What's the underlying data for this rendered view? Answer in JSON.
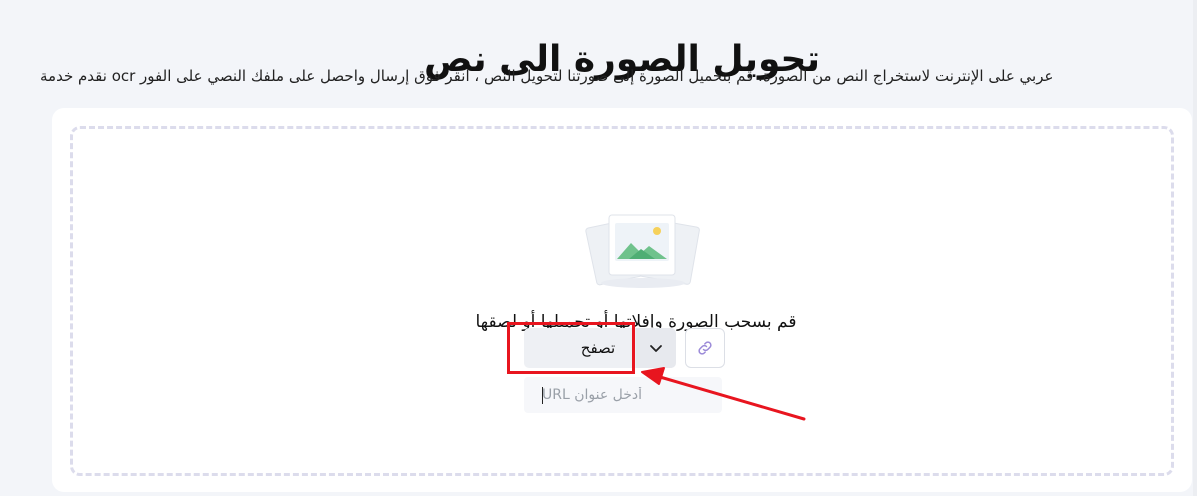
{
  "header": {
    "title": "تحويل الصورة الى نص",
    "subtitle": "نقدم خدمة ocr على الفور على ملفك النصي واحصل على إرسال فوق انقر ، النص لتحويل صورتنا إلى الصورة بتحميل قم .الصورة من النص لاستخراج الإنترنت على عربي"
  },
  "uploader": {
    "prompt": "قم بسحب الصورة وإفلاتها أو تحميلها أو لصقها",
    "browse_label": "تصفح",
    "dropdown_icon": "chevron-down-icon",
    "link_icon": "link-icon",
    "url_placeholder": "أدخل عنوان URL",
    "url_value": ""
  },
  "annotation": {
    "highlight_color": "#e8151f"
  },
  "colors": {
    "link_icon": "#9b8ad8",
    "illustration_green": "#6fc28c",
    "illustration_sun": "#f6d15a"
  }
}
